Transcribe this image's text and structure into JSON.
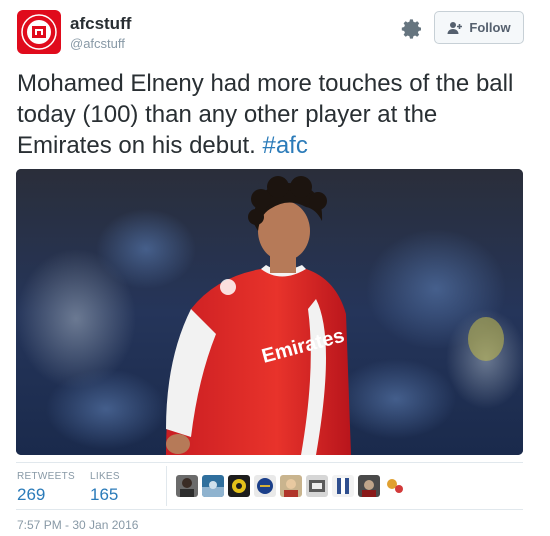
{
  "user": {
    "display_name": "afcstuff",
    "handle": "@afcstuff",
    "avatar_icon": "afc-logo-icon",
    "brand_color": "#e00b1c"
  },
  "actions": {
    "follow_label": "Follow",
    "settings_icon": "gear-icon"
  },
  "tweet": {
    "text": "Mohamed Elneny had more touches of the ball today (100) than any other player at the Emirates on his debut. ",
    "hashtag": "#afc",
    "hashtag_color": "#2b7bb9"
  },
  "photo": {
    "jersey_text": "Emirates"
  },
  "stats": {
    "retweets_label": "RETWEETS",
    "retweets_value": "269",
    "likes_label": "LIKES",
    "likes_value": "165"
  },
  "likers": [
    "liker-1",
    "liker-2",
    "liker-3",
    "liker-4",
    "liker-5",
    "liker-6",
    "liker-7",
    "liker-8",
    "liker-9",
    "liker-10"
  ],
  "timestamp": "7:57 PM - 30 Jan 2016"
}
